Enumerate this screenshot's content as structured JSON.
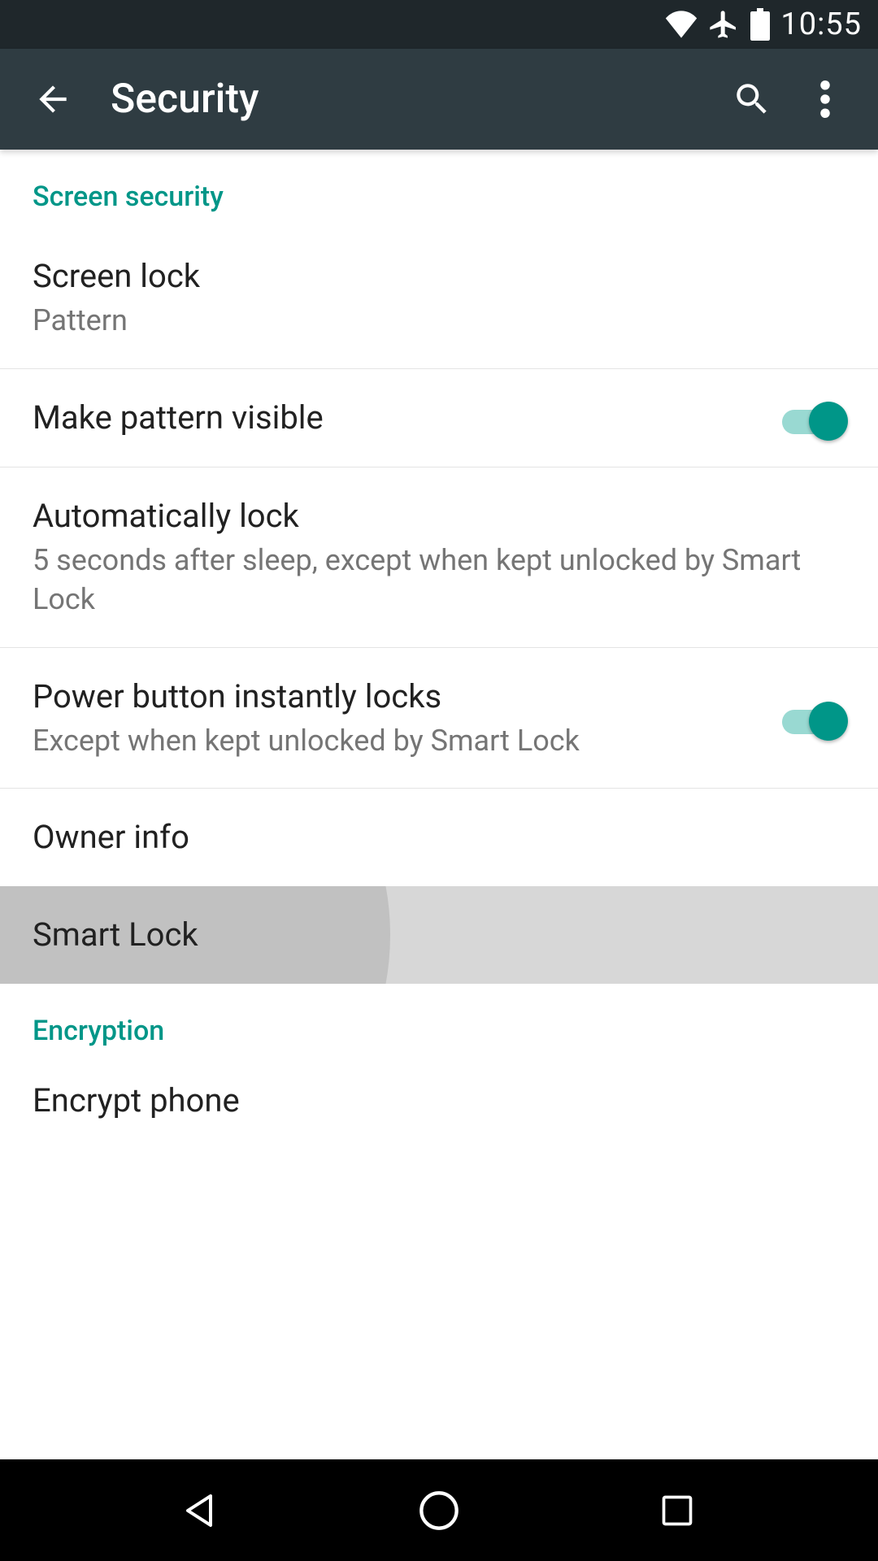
{
  "status": {
    "time": "10:55"
  },
  "header": {
    "title": "Security"
  },
  "sections": {
    "screen_security": {
      "label": "Screen security",
      "items": {
        "screen_lock": {
          "title": "Screen lock",
          "subtitle": "Pattern"
        },
        "pattern_visible": {
          "title": "Make pattern visible",
          "checked": true
        },
        "auto_lock": {
          "title": "Automatically lock",
          "subtitle": "5 seconds after sleep, except when kept unlocked by Smart Lock"
        },
        "power_lock": {
          "title": "Power button instantly locks",
          "subtitle": "Except when kept unlocked by Smart Lock",
          "checked": true
        },
        "owner_info": {
          "title": "Owner info"
        },
        "smart_lock": {
          "title": "Smart Lock"
        }
      }
    },
    "encryption": {
      "label": "Encryption",
      "items": {
        "encrypt_phone": {
          "title": "Encrypt phone"
        }
      }
    }
  }
}
